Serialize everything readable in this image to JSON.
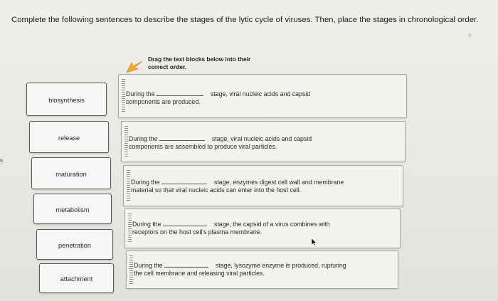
{
  "instructions": "Complete the following sentences to describe the stages of the lytic cycle of viruses. Then, place the stages in chronological order.",
  "edge_mark": "s",
  "drag_hint": {
    "line1": "Drag the text blocks below into their",
    "line2": "correct order.",
    "icon": "arrow-pointer-icon",
    "icon_color": "#f0a830"
  },
  "word_bank": [
    {
      "label": "biosynthesis"
    },
    {
      "label": "release"
    },
    {
      "label": "maturation"
    },
    {
      "label": "metabolism"
    },
    {
      "label": "penetration"
    },
    {
      "label": "attachment"
    }
  ],
  "sentences": [
    {
      "before": "During the",
      "after": "stage, viral nucleic acids and capsid",
      "line2": "components are produced."
    },
    {
      "before": "During the",
      "after": "stage, viral nucleic acids and capsid",
      "line2": "components are assembled to produce viral particles."
    },
    {
      "before": "During the",
      "after": "stage, enzymes digest cell wall and membrane",
      "line2": "material so that viral nucleic acids can enter into the host cell."
    },
    {
      "before": "During the",
      "after": "stage, the capsid of a virus combines with",
      "line2": "receptors on the host cell's plasma membrane."
    },
    {
      "before": "During the",
      "after": "stage, lysozyme enzyme is produced, rupturing",
      "line2": "the cell membrane and releasing viral particles."
    }
  ]
}
